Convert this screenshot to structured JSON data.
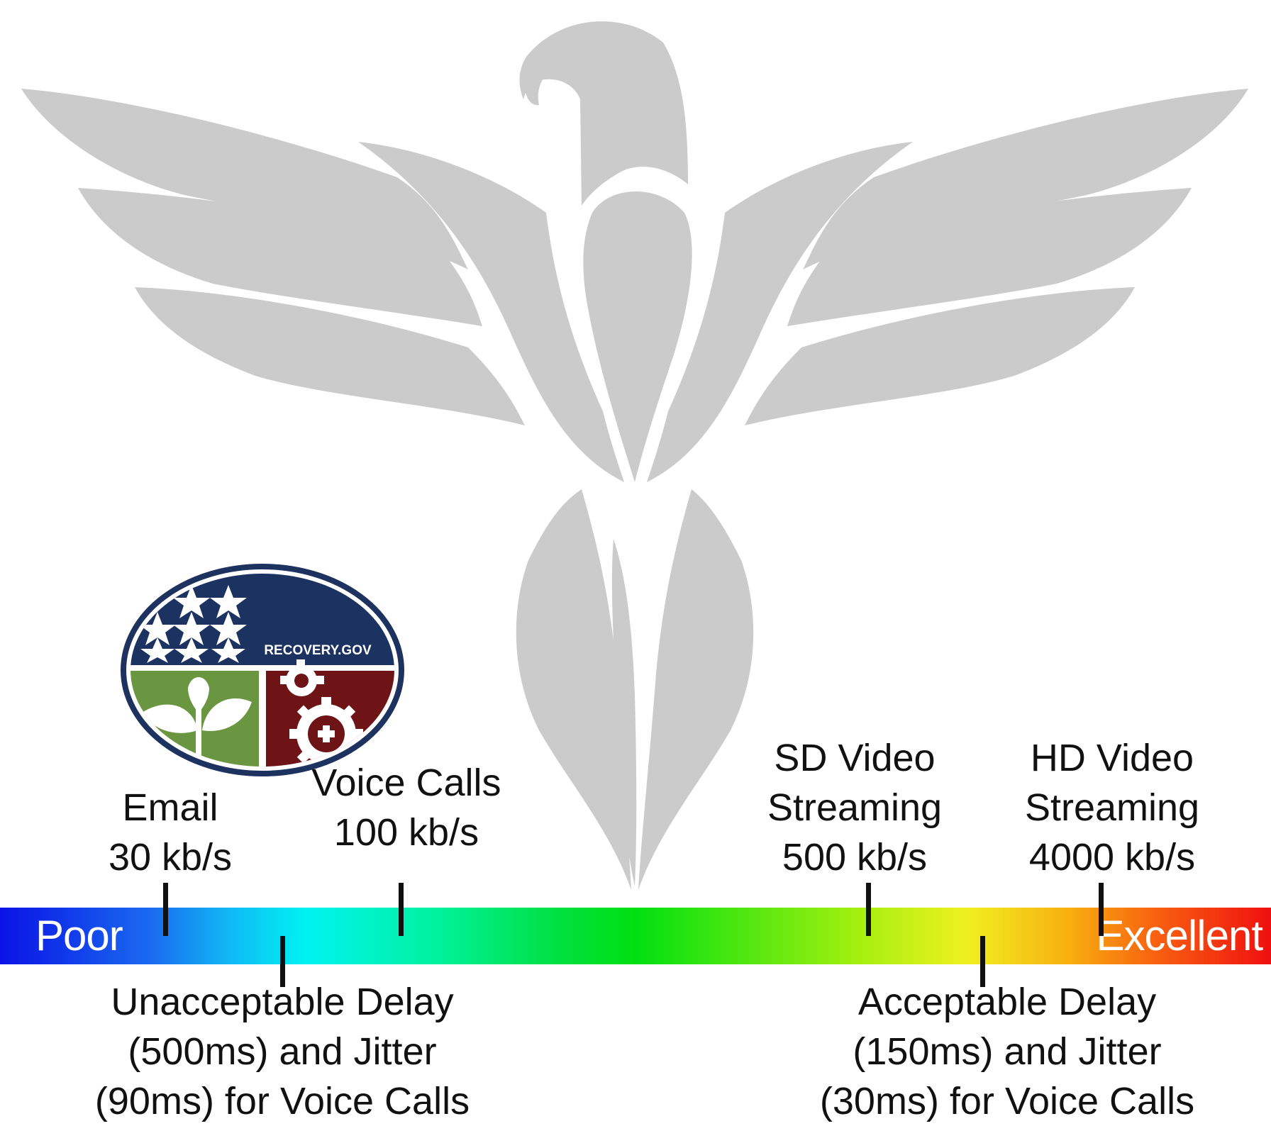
{
  "seal": {
    "text": "RECOVERY.GOV",
    "colors": {
      "ring": "#1e3260",
      "blue": "#1c3362",
      "green": "#6a9641",
      "red": "#6e1416"
    }
  },
  "eagle_color": "#cbcbcb",
  "scale": {
    "left_label": "Poor",
    "right_label": "Excellent"
  },
  "applications": [
    {
      "name": "Email",
      "rate": "30 kb/s"
    },
    {
      "name": "Voice Calls",
      "rate": "100 kb/s"
    },
    {
      "name_line1": "SD Video",
      "name_line2": "Streaming",
      "rate": "500 kb/s"
    },
    {
      "name_line1": "HD Video",
      "name_line2": "Streaming",
      "rate": "4000 kb/s"
    }
  ],
  "delays": [
    {
      "line1": "Unacceptable Delay",
      "line2": "(500ms) and Jitter",
      "line3": "(90ms) for Voice Calls"
    },
    {
      "line1": "Acceptable Delay",
      "line2": "(150ms) and Jitter",
      "line3": "(30ms) for Voice Calls"
    }
  ]
}
